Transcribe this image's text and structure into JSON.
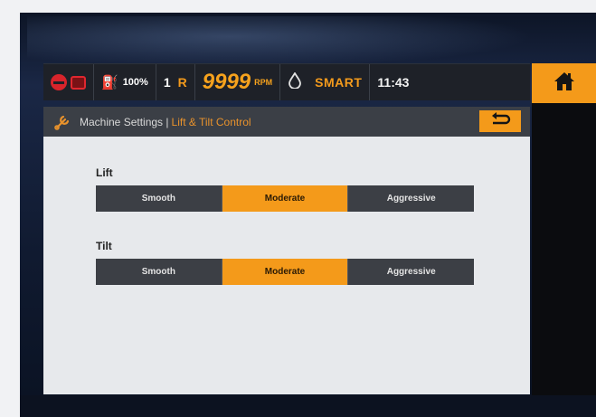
{
  "status_bar": {
    "fuel_icon": "fuel-level-icon",
    "fuel_percent": "100%",
    "gear": "1",
    "range": "R",
    "rpm_value": "9999",
    "rpm_unit": "RPM",
    "mode_icon": "drop-icon",
    "mode": "SMART",
    "time": "11:43"
  },
  "breadcrumb": {
    "icon": "machine-settings-icon",
    "section": "Machine Settings |",
    "page": "Lift & Tilt Control"
  },
  "settings": [
    {
      "label": "Lift",
      "options": [
        "Smooth",
        "Moderate",
        "Aggressive"
      ],
      "selected": "Moderate"
    },
    {
      "label": "Tilt",
      "options": [
        "Smooth",
        "Moderate",
        "Aggressive"
      ],
      "selected": "Moderate"
    }
  ],
  "colors": {
    "accent": "#f49a1a",
    "alert": "#d8242b",
    "bar": "#1e2128",
    "segment_inactive": "#3c3f45",
    "content_bg": "#e7e9ec"
  }
}
